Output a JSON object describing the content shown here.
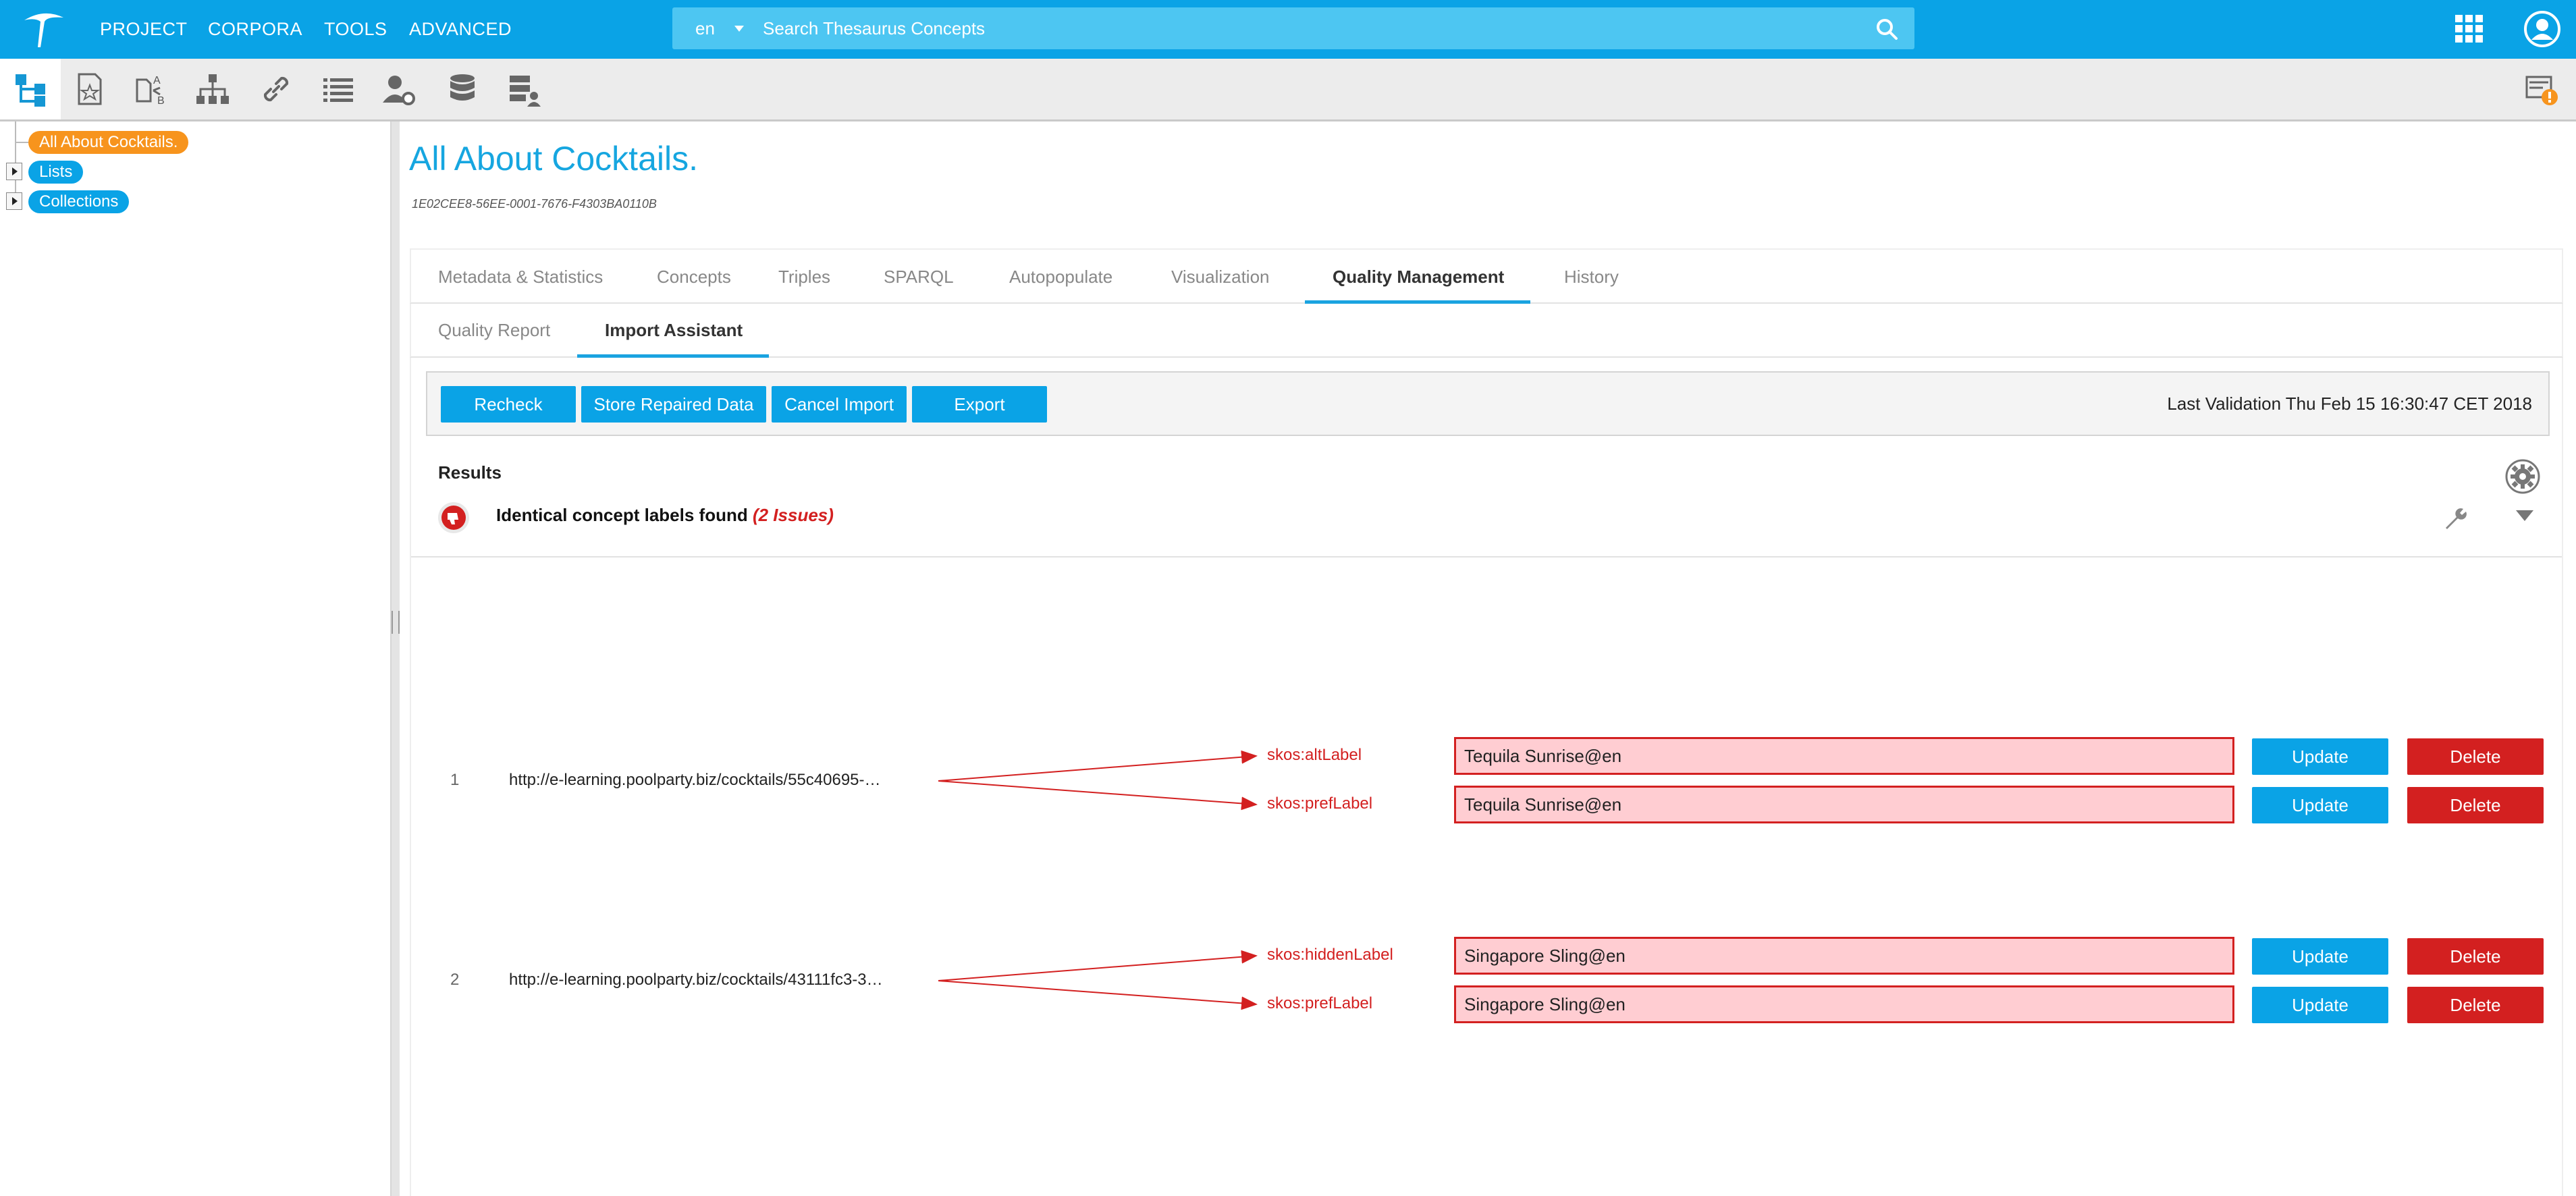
{
  "topnav": {
    "items": [
      "PROJECT",
      "CORPORA",
      "TOOLS",
      "ADVANCED"
    ]
  },
  "search": {
    "lang": "en",
    "placeholder": "Search Thesaurus Concepts"
  },
  "toolbar": {
    "icons": [
      "tree-icon",
      "bookmark-icon",
      "translate-icon",
      "hierarchy-icon",
      "link-icon",
      "list-icon",
      "user-settings-icon",
      "database-icon",
      "database-user-icon",
      "notification-warning-icon"
    ]
  },
  "sidebar": {
    "root": "All About Cocktails.",
    "nodes": [
      "Lists",
      "Collections"
    ]
  },
  "page": {
    "title": "All About Cocktails.",
    "id": "1E02CEE8-56EE-0001-7676-F4303BA0110B"
  },
  "tabs": [
    "Metadata & Statistics",
    "Concepts",
    "Triples",
    "SPARQL",
    "Autopopulate",
    "Visualization",
    "Quality Management",
    "History"
  ],
  "subtabs": [
    "Quality Report",
    "Import Assistant"
  ],
  "actions": {
    "recheck": "Recheck",
    "store": "Store Repaired Data",
    "cancel": "Cancel Import",
    "export": "Export",
    "last_validation": "Last Validation Thu Feb 15 16:30:47 CET 2018"
  },
  "results": {
    "label": "Results",
    "issue_title": "Identical concept labels found",
    "issue_count": "(2 Issues)",
    "rows": [
      {
        "num": "1",
        "uri": "http://e-learning.poolparty.biz/cocktails/55c40695-…",
        "labels": [
          {
            "prop": "skos:altLabel",
            "value": "Tequila Sunrise@en"
          },
          {
            "prop": "skos:prefLabel",
            "value": "Tequila Sunrise@en"
          }
        ]
      },
      {
        "num": "2",
        "uri": "http://e-learning.poolparty.biz/cocktails/43111fc3-3…",
        "labels": [
          {
            "prop": "skos:hiddenLabel",
            "value": "Singapore Sling@en"
          },
          {
            "prop": "skos:prefLabel",
            "value": "Singapore Sling@en"
          }
        ]
      }
    ],
    "update_label": "Update",
    "delete_label": "Delete"
  },
  "colors": {
    "brand": "#0aa3e6",
    "title": "#16a6e0",
    "danger": "#d32020",
    "label_bg": "#ffcdd2",
    "root_node": "#f7941d"
  }
}
